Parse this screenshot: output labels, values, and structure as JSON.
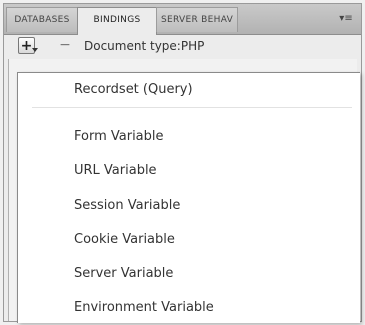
{
  "tabs": [
    {
      "label": "DATABASES",
      "active": false
    },
    {
      "label": "BINDINGS",
      "active": true
    },
    {
      "label": "SERVER BEHAV",
      "active": false
    }
  ],
  "tab_menu_label": "▾≡",
  "toolbar": {
    "plus_label": "+",
    "minus_label": "−",
    "document_type": "Document type:PHP"
  },
  "menu": {
    "items": [
      "Recordset (Query)",
      "Form Variable",
      "URL Variable",
      "Session Variable",
      "Cookie Variable",
      "Server Variable",
      "Environment Variable"
    ]
  }
}
